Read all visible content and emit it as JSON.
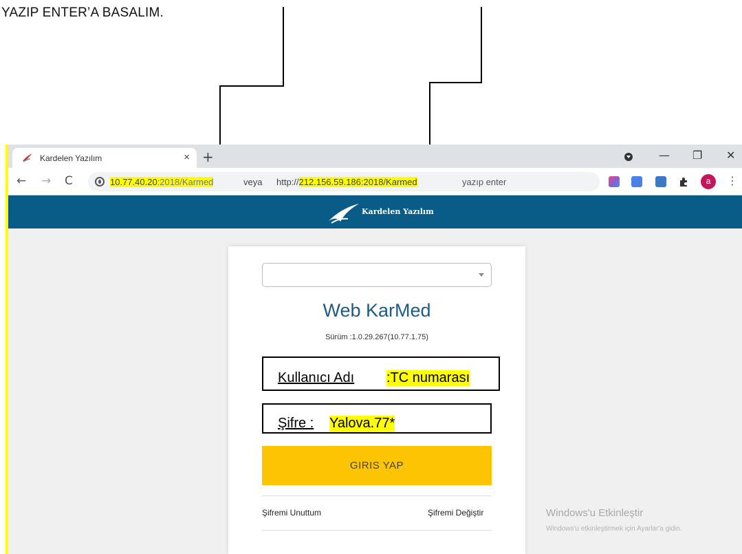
{
  "instruction": "YAZIP ENTER’A BASALIM.",
  "browser": {
    "tab_title": "Kardelen Yazılım",
    "tab_close": "×",
    "new_tab": "+",
    "window_controls": {
      "minimize": "—",
      "restore": "❐",
      "close": "✕"
    },
    "nav": {
      "back": "←",
      "forward": "→",
      "reload": "C"
    },
    "address_bar": {
      "host_highlight": "10.77.40.20",
      "host_rest": ":2018/Karmed",
      "between": "veya",
      "alt_prefix": "http://",
      "alt_highlight": "212.156.59.186:2018/Karmed",
      "suffix": "yazıp enter"
    },
    "avatar_letter": "a",
    "menu": "⋮",
    "extension_icons": [
      "screencast-icon",
      "translate-icon",
      "translate-alt-icon",
      "extensions-puzzle-icon"
    ]
  },
  "app": {
    "brand_name": "Kardelen Yazılım",
    "brand_color": "#0a5c88"
  },
  "login": {
    "title": "Web KarMed",
    "version": "Sürüm :1.0.29.267(10.77.1.75)",
    "username_label": "Kullanıcı Adı ",
    "username_value": ":TC numarası",
    "password_label": "Şifre :",
    "password_value": " Yalova.77*",
    "login_button": "GIRIS YAP",
    "forgot_password": "Şifremi Unuttum",
    "change_password": "Şifremi Değiştir",
    "button_color": "#fdc403",
    "highlight_color": "#ffff00"
  },
  "watermark": {
    "title": "Windows'u Etkinleştir",
    "subtitle": "Windows'u etkinleştirmek için Ayarlar'a gidin."
  }
}
